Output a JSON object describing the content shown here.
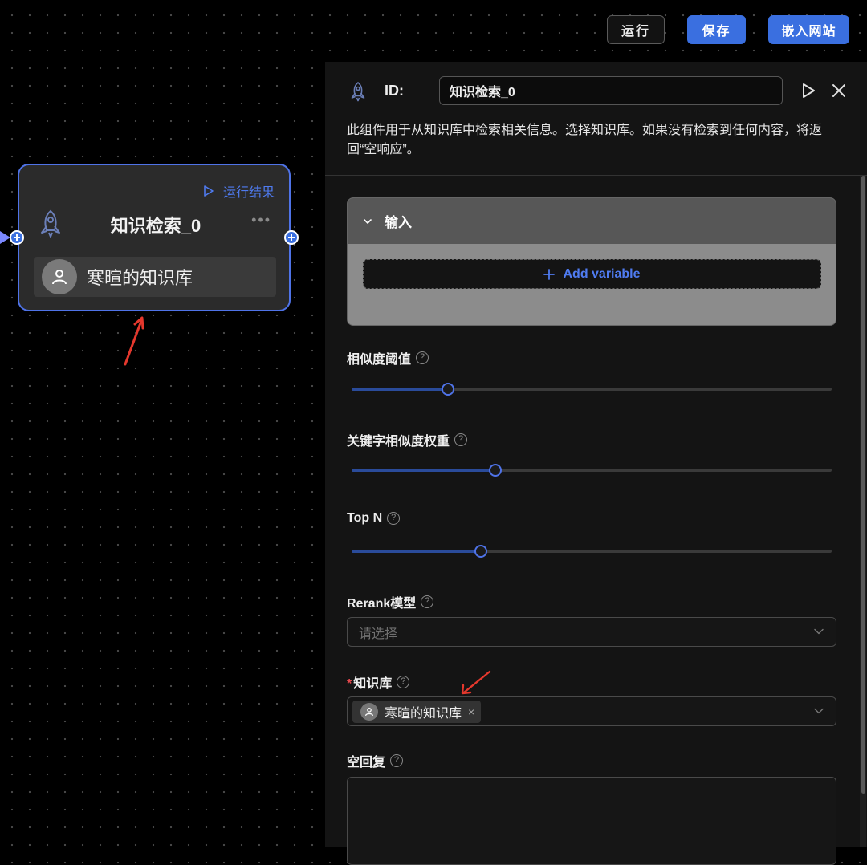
{
  "toolbar": {
    "run_label": "运行",
    "save_label": "保存",
    "embed_label": "嵌入网站"
  },
  "node": {
    "run_result_label": "运行结果",
    "title": "知识检索_0",
    "more_label": "•••",
    "kb_label": "寒暄的知识库"
  },
  "panel": {
    "id_label": "ID:",
    "id_value": "知识检索_0",
    "description": "此组件用于从知识库中检索相关信息。选择知识库。如果没有检索到任何内容，将返回“空响应”。",
    "input_section": {
      "title": "输入",
      "add_variable_label": "Add variable"
    },
    "similarity_threshold": {
      "label": "相似度阈值",
      "value": 0.2
    },
    "keyword_weight": {
      "label": "关键字相似度权重",
      "value": 0.3
    },
    "top_n": {
      "label": "Top N",
      "value": 0.27
    },
    "rerank": {
      "label": "Rerank模型",
      "placeholder": "请选择"
    },
    "knowledge_base": {
      "required_mark": "*",
      "label": "知识库",
      "selected": "寒暄的知识库",
      "remove_label": "×"
    },
    "empty_response": {
      "label": "空回复"
    }
  },
  "colors": {
    "accent": "#3a6fe0",
    "node_border": "#4f73e8",
    "annotation_arrow": "#e5382d"
  }
}
